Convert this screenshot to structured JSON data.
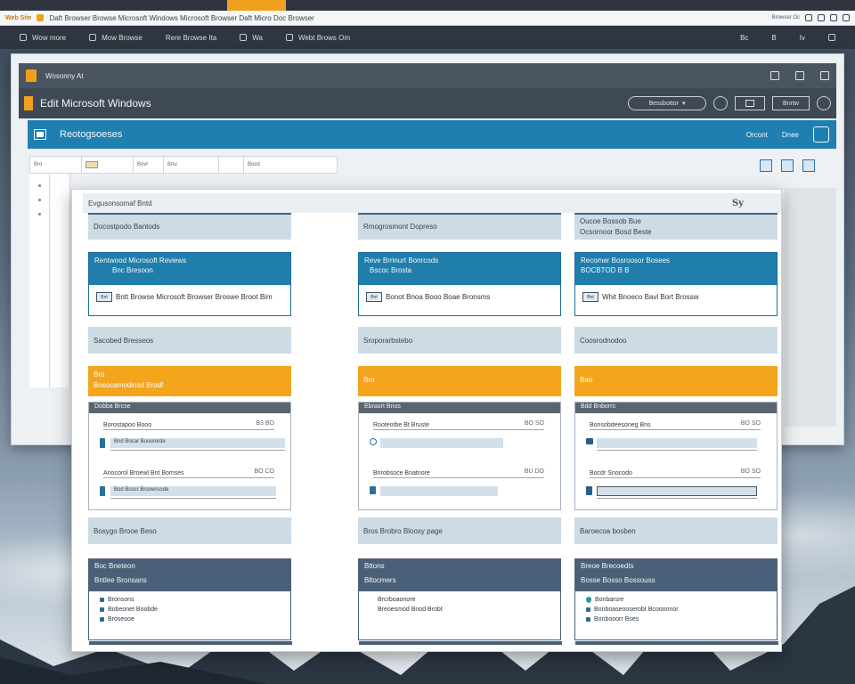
{
  "browser": {
    "site_badge": "Web Site",
    "url": "Daft Browser Browse Microsoft Windows Microsoft Browser Daft Micro Doc Browser",
    "right_text": "Browser Oc"
  },
  "appbar": {
    "items": [
      {
        "label": "Wow more",
        "icon": "menu-icon"
      },
      {
        "label": "Mow Browse",
        "icon": "brush-icon"
      },
      {
        "label": "Rere Browse Ita",
        "icon": "file-icon"
      },
      {
        "label": "Wa",
        "icon": "search-icon"
      },
      {
        "label": "Webt Brows Om",
        "icon": "tools-icon"
      }
    ],
    "right_labels": [
      "Bc",
      "B",
      "Iv"
    ]
  },
  "back_window": {
    "title": "Wosonny At",
    "app_name": "Edit Microsoft Windows",
    "combo_value": "Bessbottor",
    "tool_text": "Bnrtw",
    "ribbon_title": "Reotogsoeses",
    "ribbon_links": [
      "Orcont",
      "Dnee"
    ],
    "subtool": [
      "Bro",
      "Bovl",
      "Bnu",
      "Bocd"
    ]
  },
  "front_window": {
    "title": "Evgusonsomaf Bntd",
    "logo": "Sy",
    "columns": [
      {
        "section1": [
          "Docostpodo Bantods"
        ],
        "card": {
          "lines": [
            "Rentwood Microsoft Reviews",
            "Bnc Bresoon"
          ],
          "chip": "Bnt",
          "row": "Bntt Browse Microsoft Browser Broswe Broot Bim"
        },
        "section2": [
          "Sacobed Bresseos"
        ],
        "orange": [
          "Bro",
          "Bosocamodinsd Brodf"
        ],
        "list": {
          "head": "Dobba Brcse",
          "items": [
            {
              "label": "Borostapoo Booo",
              "value": "B3 BO",
              "bar": "Bnd Bocar Boourorde"
            },
            {
              "label": "Anocorol Broewl Bnt Bomses",
              "value": "BO CO",
              "bar": "Bod Bcocr Broowrsode"
            }
          ]
        },
        "section3": [
          "Bosygo Brooe Beso"
        ],
        "slate": {
          "title": "Boc Bneteon",
          "subtitle": "Bntlee Bronsans",
          "items": [
            "Bronsons",
            "Bobeonet Boobde",
            "Broseooe"
          ]
        }
      },
      {
        "section1": [
          "Rmogrosmont Dopreso"
        ],
        "card": {
          "lines": [
            "Reve Brrinurt Bonrcods",
            "Bscoc Brosta"
          ],
          "chip": "Bnt",
          "row": "Bonot Bnoa Booo Boae Bronsms"
        },
        "section2": [
          "Sroporarbstebo"
        ],
        "orange": [
          "Bro"
        ],
        "list": {
          "head": "Ebraort Bnos",
          "items": [
            {
              "label": "Rooteotbe Bt Bruste",
              "value": "BO SO",
              "bar": ""
            },
            {
              "label": "Bnrobsoce Bnatnore",
              "value": "BU DO",
              "bar": ""
            }
          ]
        },
        "section3": [
          "Bros Brobro Bloosy page"
        ],
        "slate": {
          "title": "Bttons",
          "subtitle": "Bltocmers",
          "items": [
            "Brcrboaonore",
            "Breoesmod Bnod Brobt"
          ]
        }
      },
      {
        "section1": [
          "Oucoe Bossob Bue",
          "Ocsornoor Bosd Beste"
        ],
        "card": {
          "lines": [
            "Recomer Bosroosor Bosees",
            "BOCBTOD B B"
          ],
          "chip": "Bnt",
          "row": "Whit Bnoeco Bavl Bort Brossw"
        },
        "section2": [
          "Coosrodnodoo"
        ],
        "orange": [
          "Bao"
        ],
        "list": {
          "head": "Bdd Bnborrs",
          "items": [
            {
              "label": "Bonsobdeesoneg Bns",
              "value": "BO SO",
              "bar": ""
            },
            {
              "label": "Bocdr Snocodo",
              "value": "BO SO",
              "bar": ""
            }
          ]
        },
        "section3": [
          "Baroecoa bosben"
        ],
        "slate": {
          "title": "Breoe Brecoedts",
          "subtitle": "Bosse Bosso Bossouss",
          "items": [
            "Bonbarsre",
            "Bonboaseooserobt Bcoooonor",
            "Bonbooorr Bses"
          ]
        }
      }
    ]
  },
  "colors": {
    "accent_orange": "#f4a51e",
    "accent_blue": "#1f7eab",
    "slate": "#4a6078"
  }
}
